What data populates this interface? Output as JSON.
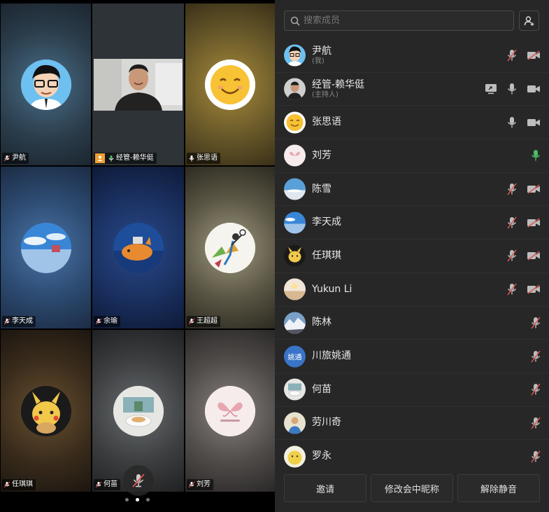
{
  "tiles": [
    {
      "name": "尹航",
      "muted": true
    },
    {
      "name": "经管-赖华侹",
      "muted": false,
      "host": true,
      "active": true
    },
    {
      "name": "张思语",
      "muted": false
    },
    {
      "name": "李天成",
      "muted": true
    },
    {
      "name": "余瑜",
      "muted": true
    },
    {
      "name": "王超超",
      "muted": true
    },
    {
      "name": "任琪琪",
      "muted": true
    },
    {
      "name": "何苗",
      "muted": true
    },
    {
      "name": "刘芳",
      "muted": true
    }
  ],
  "pager": {
    "pages": 3,
    "current": 1
  },
  "search": {
    "placeholder": "搜索成员"
  },
  "members": [
    {
      "name": "尹航",
      "sub": "(我)",
      "mic": "off",
      "cam": "off",
      "share": false
    },
    {
      "name": "经管-赖华侹",
      "sub": "(主持人)",
      "mic": "on",
      "cam": "on",
      "share": true
    },
    {
      "name": "张思语",
      "sub": "",
      "mic": "on",
      "cam": "on",
      "share": false
    },
    {
      "name": "刘芳",
      "sub": "",
      "mic": "talking",
      "cam": "none",
      "share": false
    },
    {
      "name": "陈雪",
      "sub": "",
      "mic": "off",
      "cam": "off",
      "share": false
    },
    {
      "name": "李天成",
      "sub": "",
      "mic": "off",
      "cam": "off",
      "share": false
    },
    {
      "name": "任琪琪",
      "sub": "",
      "mic": "off",
      "cam": "off",
      "share": false
    },
    {
      "name": "Yukun Li",
      "sub": "",
      "mic": "off",
      "cam": "off",
      "share": false
    },
    {
      "name": "陈林",
      "sub": "",
      "mic": "off",
      "cam": "none",
      "share": false
    },
    {
      "name": "川旅姚通",
      "sub": "",
      "mic": "off",
      "cam": "none",
      "share": false,
      "avatar_text": "姚通"
    },
    {
      "name": "何苗",
      "sub": "",
      "mic": "off",
      "cam": "none",
      "share": false
    },
    {
      "name": "劳川奇",
      "sub": "",
      "mic": "off",
      "cam": "none",
      "share": false
    },
    {
      "name": "罗永",
      "sub": "",
      "mic": "off",
      "cam": "none",
      "share": false
    }
  ],
  "bottom": {
    "invite": "邀请",
    "rename": "修改会中昵称",
    "unmute_all": "解除静音"
  },
  "colors": {
    "accent_green": "#4dbb63",
    "panel_bg": "#272727",
    "muted_red": "#d9534f"
  }
}
